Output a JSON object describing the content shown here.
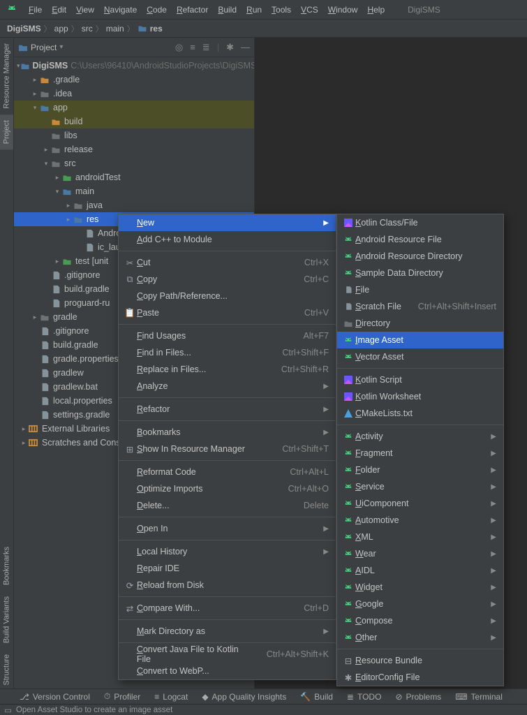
{
  "menubar": {
    "items": [
      "File",
      "Edit",
      "View",
      "Navigate",
      "Code",
      "Refactor",
      "Build",
      "Run",
      "Tools",
      "VCS",
      "Window",
      "Help"
    ],
    "product": "DigiSMS"
  },
  "breadcrumb": [
    "DigiSMS",
    "app",
    "src",
    "main",
    "res"
  ],
  "project_panel": {
    "title": "Project",
    "root_name": "DigiSMS",
    "root_path": "C:\\Users\\96410\\AndroidStudioProjects\\DigiSMS",
    "tree": [
      {
        "depth": 1,
        "arrow": "right",
        "icon": "folder-orange",
        "label": ".gradle"
      },
      {
        "depth": 1,
        "arrow": "right",
        "icon": "folder-gray",
        "label": ".idea"
      },
      {
        "depth": 1,
        "arrow": "down",
        "icon": "folder-blue",
        "label": "app",
        "hl": true
      },
      {
        "depth": 2,
        "arrow": "none",
        "icon": "folder-orange",
        "label": "build",
        "hl": true
      },
      {
        "depth": 2,
        "arrow": "none",
        "icon": "folder-gray",
        "label": "libs"
      },
      {
        "depth": 2,
        "arrow": "right",
        "icon": "folder-gray",
        "label": "release"
      },
      {
        "depth": 2,
        "arrow": "down",
        "icon": "folder-gray",
        "label": "src"
      },
      {
        "depth": 3,
        "arrow": "right",
        "icon": "folder-green",
        "label": "androidTest"
      },
      {
        "depth": 3,
        "arrow": "down",
        "icon": "folder-blue",
        "label": "main"
      },
      {
        "depth": 4,
        "arrow": "right",
        "icon": "folder-gray",
        "label": "java"
      },
      {
        "depth": 4,
        "arrow": "right",
        "icon": "folder-blue",
        "label": "res",
        "selected": true
      },
      {
        "depth": 5,
        "arrow": "none",
        "icon": "file",
        "label": "Andro"
      },
      {
        "depth": 5,
        "arrow": "none",
        "icon": "file",
        "label": "ic_lau"
      },
      {
        "depth": 3,
        "arrow": "right",
        "icon": "folder-green",
        "label": "test [unit"
      },
      {
        "depth": 2,
        "arrow": "none",
        "icon": "file",
        "label": ".gitignore"
      },
      {
        "depth": 2,
        "arrow": "none",
        "icon": "file",
        "label": "build.gradle"
      },
      {
        "depth": 2,
        "arrow": "none",
        "icon": "file",
        "label": "proguard-ru"
      },
      {
        "depth": 1,
        "arrow": "right",
        "icon": "folder-gray",
        "label": "gradle"
      },
      {
        "depth": 1,
        "arrow": "none",
        "icon": "file",
        "label": ".gitignore"
      },
      {
        "depth": 1,
        "arrow": "none",
        "icon": "file",
        "label": "build.gradle"
      },
      {
        "depth": 1,
        "arrow": "none",
        "icon": "file",
        "label": "gradle.properties"
      },
      {
        "depth": 1,
        "arrow": "none",
        "icon": "file",
        "label": "gradlew"
      },
      {
        "depth": 1,
        "arrow": "none",
        "icon": "file",
        "label": "gradlew.bat"
      },
      {
        "depth": 1,
        "arrow": "none",
        "icon": "file",
        "label": "local.properties"
      },
      {
        "depth": 1,
        "arrow": "none",
        "icon": "file",
        "label": "settings.gradle"
      },
      {
        "depth": 0,
        "arrow": "right",
        "icon": "lib",
        "label": "External Libraries"
      },
      {
        "depth": 0,
        "arrow": "right",
        "icon": "lib",
        "label": "Scratches and Cons"
      }
    ]
  },
  "context_menu_1": {
    "groups": [
      [
        {
          "label": "New",
          "sub": true,
          "hl": true
        },
        {
          "label": "Add C++ to Module"
        }
      ],
      [
        {
          "icon": "cut",
          "label": "Cut",
          "accel": "Ctrl+X"
        },
        {
          "icon": "copy",
          "label": "Copy",
          "accel": "Ctrl+C"
        },
        {
          "label": "Copy Path/Reference..."
        },
        {
          "icon": "paste",
          "label": "Paste",
          "accel": "Ctrl+V"
        }
      ],
      [
        {
          "label": "Find Usages",
          "accel": "Alt+F7"
        },
        {
          "label": "Find in Files...",
          "accel": "Ctrl+Shift+F"
        },
        {
          "label": "Replace in Files...",
          "accel": "Ctrl+Shift+R"
        },
        {
          "label": "Analyze",
          "sub": true
        }
      ],
      [
        {
          "label": "Refactor",
          "sub": true
        }
      ],
      [
        {
          "label": "Bookmarks",
          "sub": true
        },
        {
          "icon": "resource",
          "label": "Show In Resource Manager",
          "accel": "Ctrl+Shift+T"
        }
      ],
      [
        {
          "label": "Reformat Code",
          "accel": "Ctrl+Alt+L"
        },
        {
          "label": "Optimize Imports",
          "accel": "Ctrl+Alt+O"
        },
        {
          "label": "Delete...",
          "accel": "Delete"
        }
      ],
      [
        {
          "label": "Open In",
          "sub": true
        }
      ],
      [
        {
          "label": "Local History",
          "sub": true
        },
        {
          "label": "Repair IDE"
        },
        {
          "icon": "reload",
          "label": "Reload from Disk"
        }
      ],
      [
        {
          "icon": "compare",
          "label": "Compare With...",
          "accel": "Ctrl+D"
        }
      ],
      [
        {
          "label": "Mark Directory as",
          "sub": true
        }
      ],
      [
        {
          "label": "Convert Java File to Kotlin File",
          "accel": "Ctrl+Alt+Shift+K"
        },
        {
          "label": "Convert to WebP..."
        }
      ]
    ]
  },
  "context_menu_2": {
    "groups": [
      [
        {
          "icon": "kt",
          "label": "Kotlin Class/File"
        },
        {
          "icon": "andr",
          "label": "Android Resource File"
        },
        {
          "icon": "andr",
          "label": "Android Resource Directory"
        },
        {
          "icon": "andr",
          "label": "Sample Data Directory"
        },
        {
          "icon": "file",
          "label": "File"
        },
        {
          "icon": "file",
          "label": "Scratch File",
          "accel": "Ctrl+Alt+Shift+Insert"
        },
        {
          "icon": "folder",
          "label": "Directory"
        },
        {
          "icon": "andr",
          "label": "Image Asset",
          "hl": true
        },
        {
          "icon": "andr",
          "label": "Vector Asset"
        }
      ],
      [
        {
          "icon": "kt",
          "label": "Kotlin Script"
        },
        {
          "icon": "kt",
          "label": "Kotlin Worksheet"
        },
        {
          "icon": "cmake",
          "label": "CMakeLists.txt"
        }
      ],
      [
        {
          "icon": "andr",
          "label": "Activity",
          "sub": true
        },
        {
          "icon": "andr",
          "label": "Fragment",
          "sub": true
        },
        {
          "icon": "andr",
          "label": "Folder",
          "sub": true
        },
        {
          "icon": "andr",
          "label": "Service",
          "sub": true
        },
        {
          "icon": "andr",
          "label": "UiComponent",
          "sub": true
        },
        {
          "icon": "andr",
          "label": "Automotive",
          "sub": true
        },
        {
          "icon": "andr",
          "label": "XML",
          "sub": true
        },
        {
          "icon": "andr",
          "label": "Wear",
          "sub": true
        },
        {
          "icon": "andr",
          "label": "AIDL",
          "sub": true
        },
        {
          "icon": "andr",
          "label": "Widget",
          "sub": true
        },
        {
          "icon": "andr",
          "label": "Google",
          "sub": true
        },
        {
          "icon": "andr",
          "label": "Compose",
          "sub": true
        },
        {
          "icon": "andr",
          "label": "Other",
          "sub": true
        }
      ],
      [
        {
          "icon": "bundle",
          "label": "Resource Bundle"
        },
        {
          "icon": "gear",
          "label": "EditorConfig File"
        }
      ]
    ]
  },
  "left_tabs": {
    "top": [
      "Resource Manager",
      "Project"
    ],
    "bottom": [
      "Bookmarks",
      "Build Variants",
      "Structure"
    ]
  },
  "bottom_tabs": [
    "Version Control",
    "Profiler",
    "Logcat",
    "App Quality Insights",
    "Build",
    "TODO",
    "Problems",
    "Terminal"
  ],
  "status_text": "Open Asset Studio to create an image asset"
}
